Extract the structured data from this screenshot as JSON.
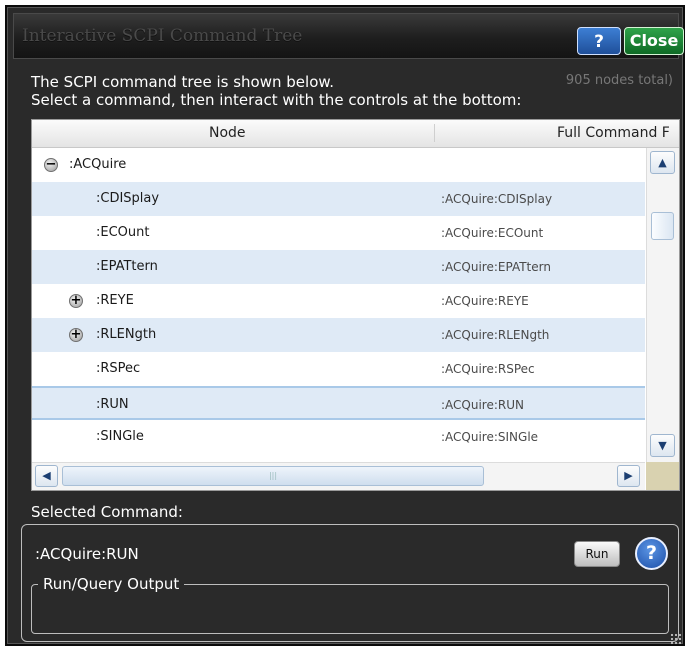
{
  "window": {
    "title": "Interactive SCPI Command Tree",
    "help_label": "?",
    "close_label": "Close"
  },
  "intro": {
    "line1": "The SCPI command tree is shown below.",
    "line2": "Select a command, then interact with the controls at the bottom:",
    "node_count": "905 nodes total)"
  },
  "tree": {
    "columns": {
      "node": "Node",
      "full_command": "Full Command F"
    },
    "rows": [
      {
        "node": ":ACQuire",
        "full": "",
        "expander": "minus"
      },
      {
        "node": ":CDISplay",
        "full": ":ACQuire:CDISplay",
        "expander": ""
      },
      {
        "node": ":ECOunt",
        "full": ":ACQuire:ECOunt",
        "expander": ""
      },
      {
        "node": ":EPATtern",
        "full": ":ACQuire:EPATtern",
        "expander": ""
      },
      {
        "node": ":REYE",
        "full": ":ACQuire:REYE",
        "expander": "plus"
      },
      {
        "node": ":RLENgth",
        "full": ":ACQuire:RLENgth",
        "expander": "plus"
      },
      {
        "node": ":RSPec",
        "full": ":ACQuire:RSPec",
        "expander": ""
      },
      {
        "node": ":RUN",
        "full": ":ACQuire:RUN",
        "expander": "",
        "selected": true
      },
      {
        "node": ":SINGle",
        "full": ":ACQuire:SINGle",
        "expander": ""
      }
    ],
    "scroll_up": "▲",
    "scroll_down": "▼",
    "scroll_left": "◀",
    "scroll_right": "▶",
    "hthumb_grip": "|||"
  },
  "selected": {
    "label": "Selected Command:",
    "command": ":ACQuire:RUN",
    "run_label": "Run",
    "help_label": "?",
    "output_legend": "Run/Query Output",
    "output_text": ""
  }
}
